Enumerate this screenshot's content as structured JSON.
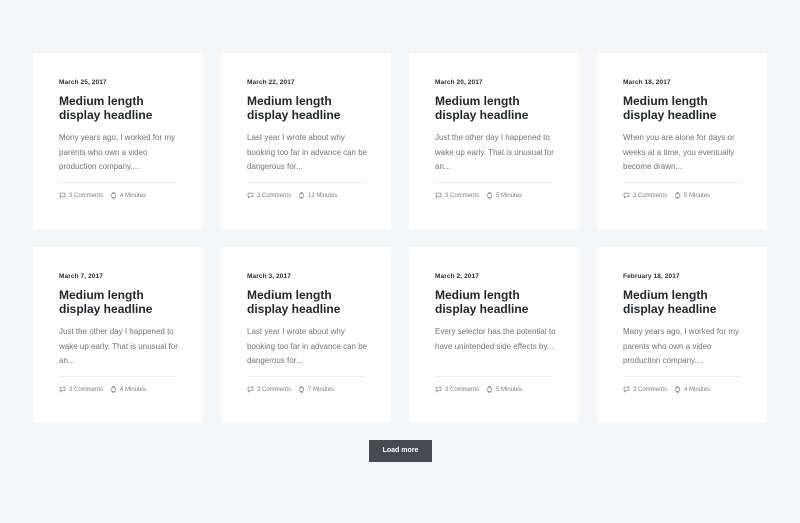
{
  "posts": [
    {
      "date": "March 25, 2017",
      "headline": "Medium length display headline",
      "excerpt": "Mony years ago, I worked for my parents who own a video production company....",
      "comments": "3 Comments",
      "read_time": "4 Minutes"
    },
    {
      "date": "March 22, 2017",
      "headline": "Medium length display headline",
      "excerpt": "Last year I wrote about why booking too far in advance can be dangerous for...",
      "comments": "3 Comments",
      "read_time": "12 Minutes"
    },
    {
      "date": "March 20, 2017",
      "headline": "Medium length display headline",
      "excerpt": "Just the other day I happened to wake up early. That is unusual for an...",
      "comments": "3 Comments",
      "read_time": "5 Minutes"
    },
    {
      "date": "March 18, 2017",
      "headline": "Medium length display headline",
      "excerpt": "When you are alone for days or weeks at a time, you eventually become drawn...",
      "comments": "3 Comments",
      "read_time": "5 Minutes"
    },
    {
      "date": "March 7, 2017",
      "headline": "Medium length display headline",
      "excerpt": "Just the other day I happened to wake up early. That is unusual for an...",
      "comments": "3 Comments",
      "read_time": "4 Minutes"
    },
    {
      "date": "March 3, 2017",
      "headline": "Medium length display headline",
      "excerpt": "Last year I wrote about why booking too far in advance can be dangerous for...",
      "comments": "3 Comments",
      "read_time": "7 Minutes"
    },
    {
      "date": "March 2, 2017",
      "headline": "Medium length display headline",
      "excerpt": "Every selector has the potential to have unintended side effects by...",
      "comments": "3 Comments",
      "read_time": "5 Minutes"
    },
    {
      "date": "February 18, 2017",
      "headline": "Medium length display headline",
      "excerpt": "Many years ago, I worked for my parents who own a video production company....",
      "comments": "3 Comments",
      "read_time": "4 Minutes"
    }
  ],
  "icons": {
    "comments": "comment-icon",
    "read_time": "watch-icon"
  },
  "load_more_label": "Load more",
  "colors": {
    "background": "#f5f6f7",
    "card": "#ffffff",
    "button": "#454b51",
    "text": "#23272b",
    "muted": "#6f757b"
  }
}
